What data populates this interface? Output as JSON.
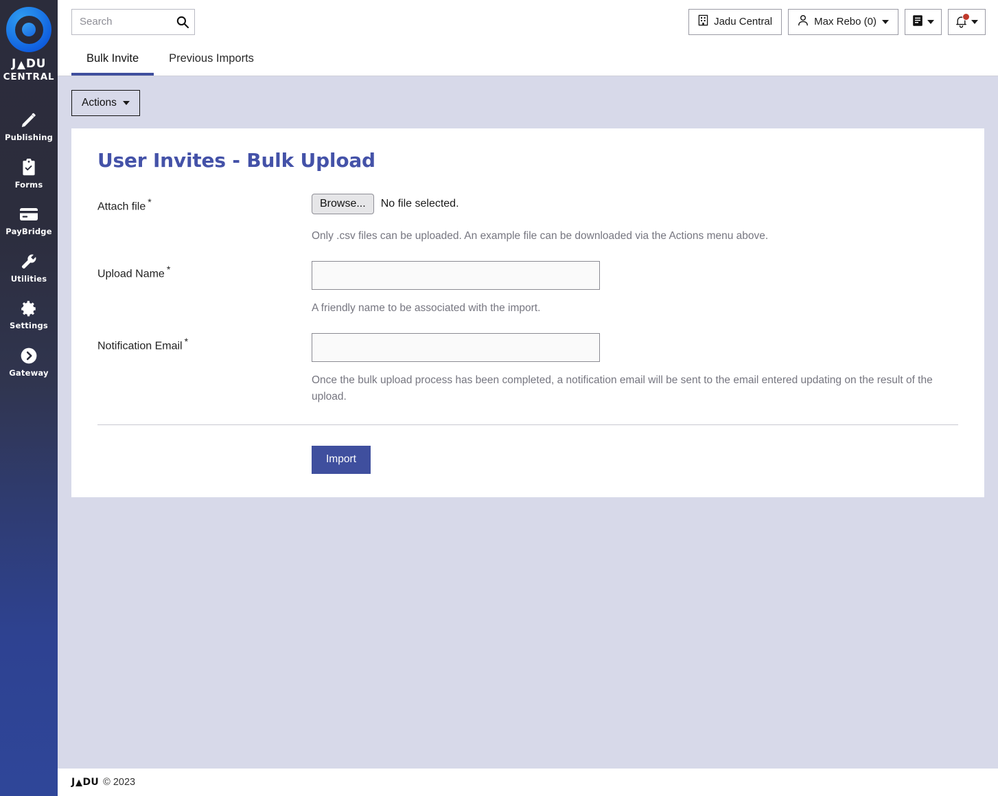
{
  "sidebar": {
    "logo": {
      "word_left": "J",
      "word_right": "DU",
      "subtitle": "CENTRAL",
      "icon": "jadu-donut-logo"
    },
    "items": [
      {
        "label": "Publishing",
        "icon": "pencil-icon"
      },
      {
        "label": "Forms",
        "icon": "clipboard-check-icon"
      },
      {
        "label": "PayBridge",
        "icon": "credit-card-icon"
      },
      {
        "label": "Utilities",
        "icon": "wrench-icon"
      },
      {
        "label": "Settings",
        "icon": "gear-icon"
      },
      {
        "label": "Gateway",
        "icon": "chevron-right-circle-icon"
      }
    ]
  },
  "topbar": {
    "search": {
      "placeholder": "Search",
      "value": "",
      "icon": "search-icon"
    },
    "site_switcher": {
      "label": "Jadu Central",
      "icon": "building-icon"
    },
    "user_menu": {
      "label": "Max Rebo (0)",
      "icon": "user-icon"
    },
    "docs_menu": {
      "icon": "book-icon"
    },
    "notifications": {
      "icon": "bell-icon",
      "badge_color": "#c0392b",
      "has_badge": true
    }
  },
  "tabs": [
    {
      "label": "Bulk Invite",
      "active": true
    },
    {
      "label": "Previous Imports",
      "active": false
    }
  ],
  "toolbar": {
    "actions_label": "Actions"
  },
  "card": {
    "title": "User Invites - Bulk Upload",
    "fields": {
      "attach_file": {
        "label": "Attach file",
        "required_marker": "*",
        "browse_label": "Browse...",
        "file_status": "No file selected.",
        "hint": "Only .csv files can be uploaded. An example file can be downloaded via the Actions menu above."
      },
      "upload_name": {
        "label": "Upload Name",
        "required_marker": "*",
        "value": "",
        "placeholder": "",
        "hint": "A friendly name to be associated with the import."
      },
      "notification_email": {
        "label": "Notification Email",
        "required_marker": "*",
        "value": "",
        "placeholder": "",
        "hint": "Once the bulk upload process has been completed, a notification email will be sent to the email entered updating on the result of the upload."
      }
    },
    "submit_label": "Import"
  },
  "footer": {
    "logo_left": "J",
    "logo_right": "DU",
    "copyright": "© 2023"
  },
  "colors": {
    "accent": "#3f4f9e",
    "heading": "#4452a8",
    "page_bg": "#d7d9e9",
    "badge": "#c0392b"
  }
}
